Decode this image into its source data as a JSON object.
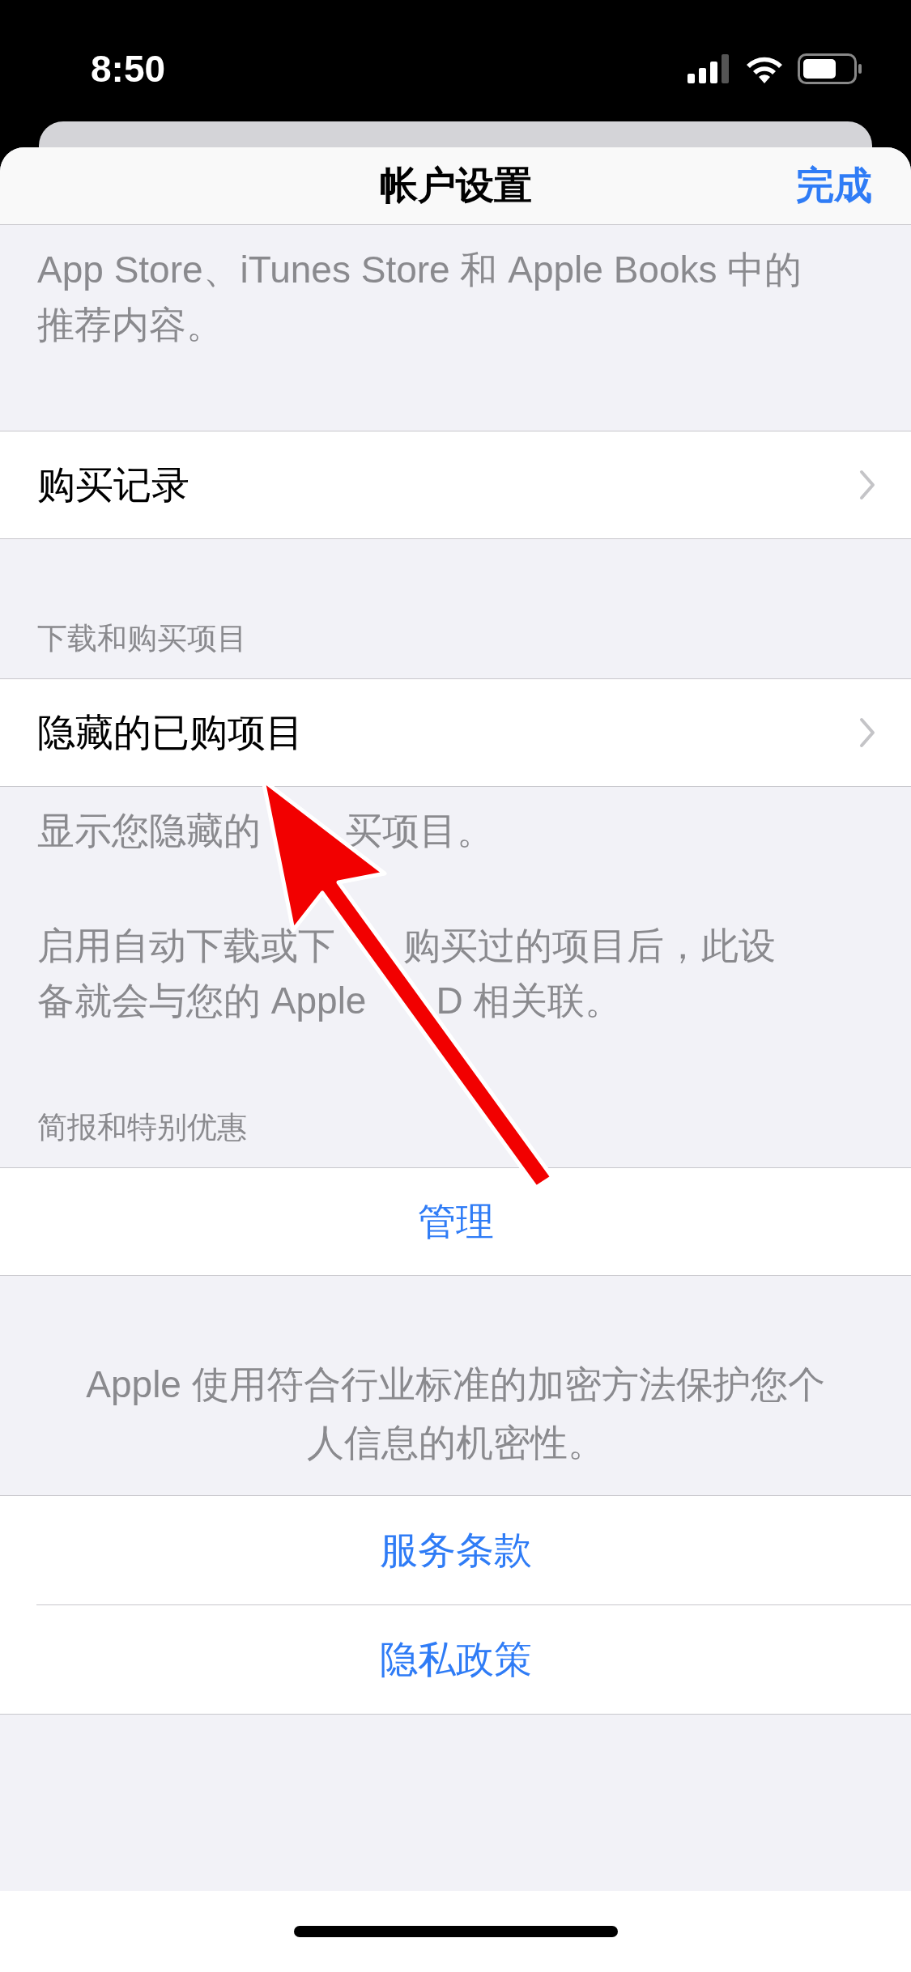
{
  "status_bar": {
    "time": "8:50"
  },
  "nav": {
    "title": "帐户设置",
    "done": "完成"
  },
  "intro_note": "App Store、iTunes Store 和 Apple Books 中的推荐内容。",
  "sections": [
    {
      "rows": [
        {
          "label": "购买记录",
          "kind": "link"
        }
      ]
    },
    {
      "header": "下载和购买项目",
      "rows": [
        {
          "label": "隐藏的已购项目",
          "kind": "link"
        }
      ],
      "footer": [
        [
          [
            "显示您隐藏的",
            "买项目。"
          ]
        ],
        [
          [
            "启用自动下载或下",
            "购买过的项目后，此设"
          ],
          [
            "备就会与您的 Apple",
            "D 相关联。"
          ]
        ]
      ]
    },
    {
      "header": "简报和特别优惠",
      "rows": [
        {
          "label": "管理",
          "kind": "action"
        }
      ]
    }
  ],
  "privacy_note": "Apple 使用符合行业标准的加密方法保护您个人信息的机密性。",
  "legal_links": [
    "服务条款",
    "隐私政策"
  ]
}
